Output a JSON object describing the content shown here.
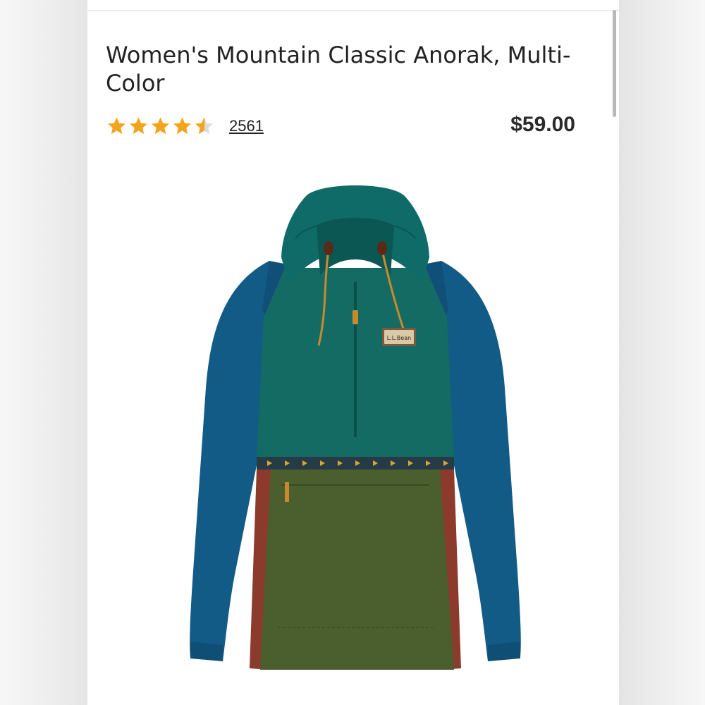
{
  "product": {
    "title": "Women's Mountain Classic Anorak, Multi-Color",
    "rating": 4.5,
    "rating_max": 5,
    "review_count": "2561",
    "price": "$59.00",
    "image_alt": "Women's Mountain Classic Anorak in Multi-Color",
    "brand_label": "L.L.Bean"
  },
  "colors": {
    "star": "#f4a41c",
    "star_empty": "#d9d9d9",
    "hood_teal": "#0f6b68",
    "sleeve_blue": "#125b86",
    "body_teal": "#146b63",
    "pocket_olive": "#4b5e2e",
    "side_rust": "#8c3a2c",
    "cord": "#c98a2d"
  }
}
